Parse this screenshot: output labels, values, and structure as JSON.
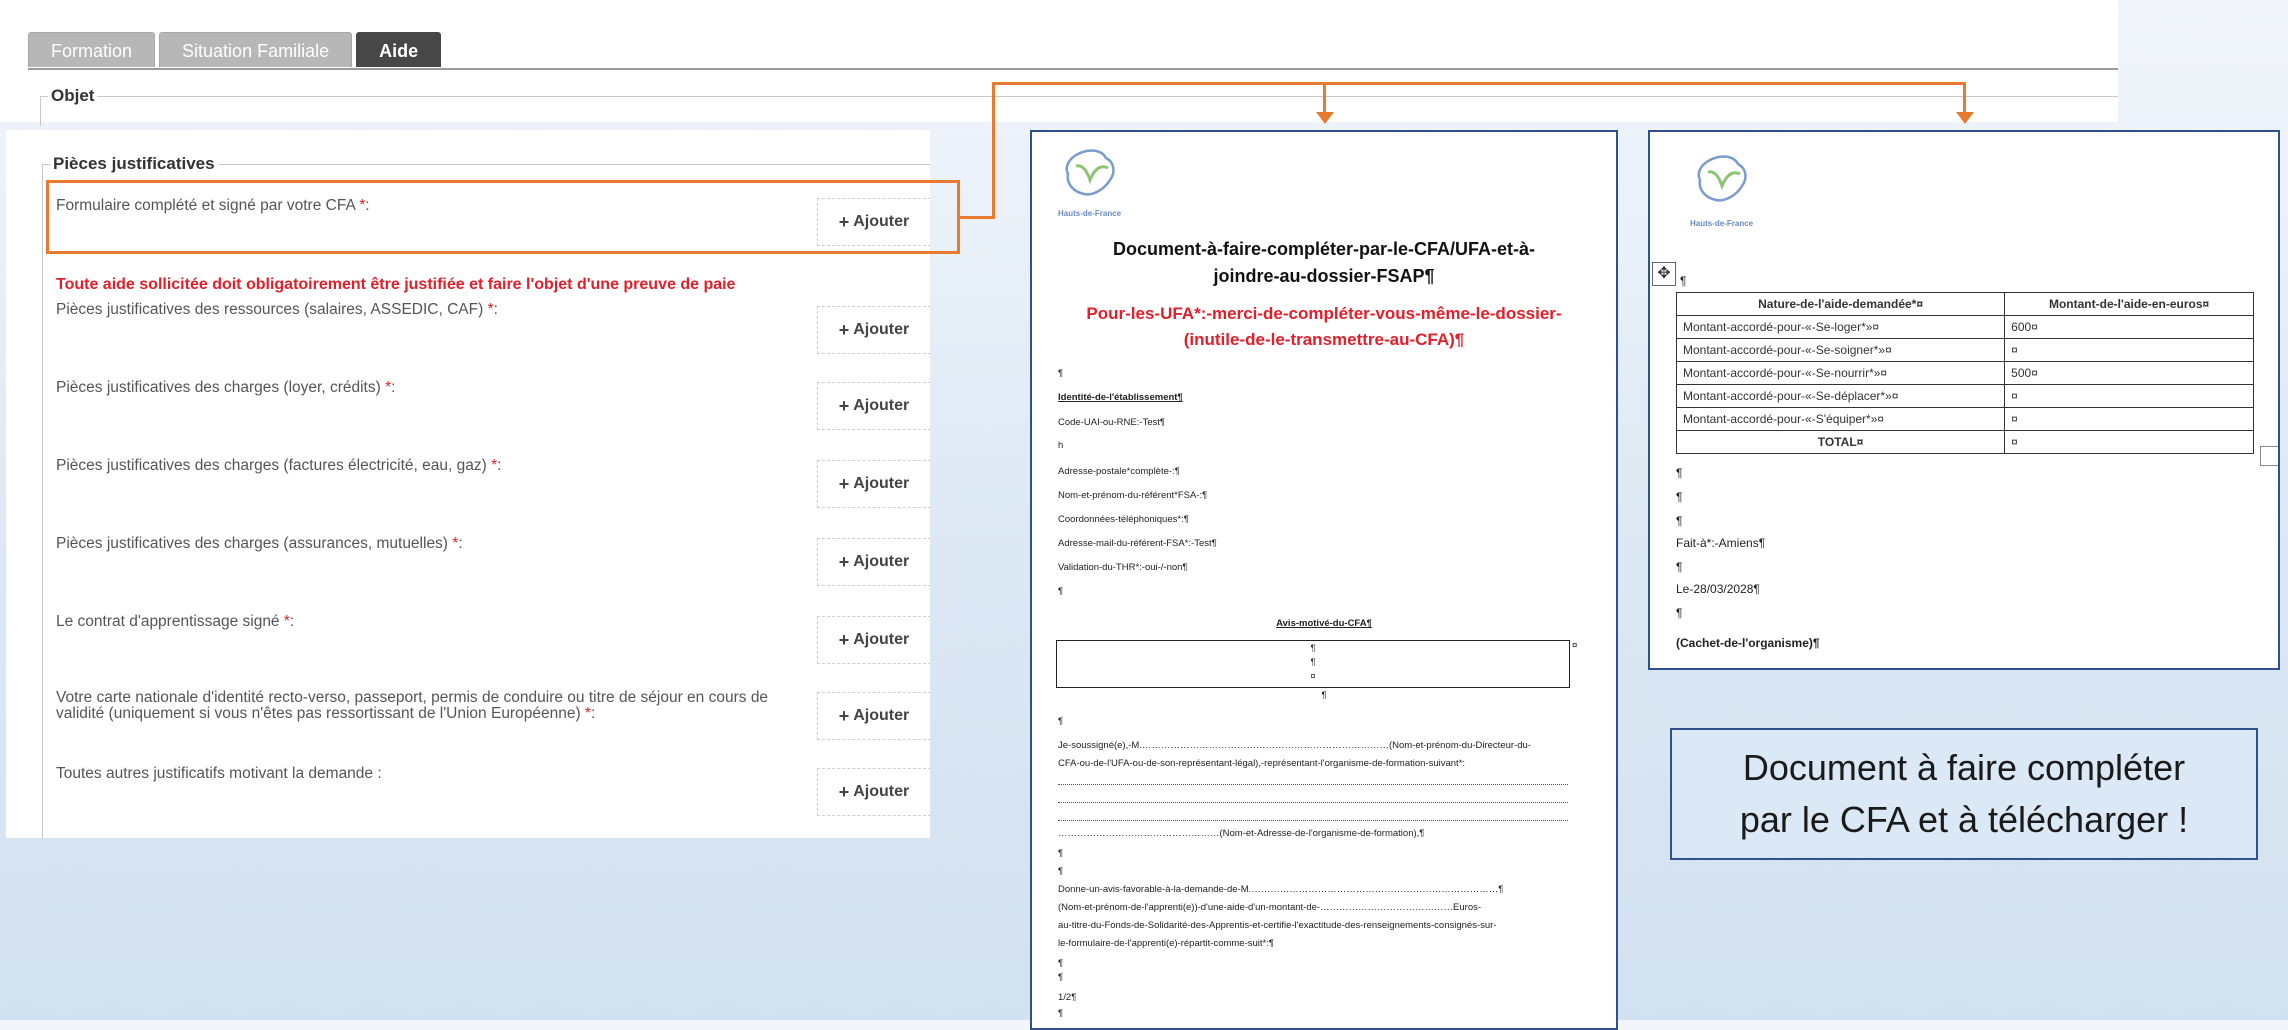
{
  "tabs": [
    {
      "label": "Formation",
      "active": false
    },
    {
      "label": "Situation Familiale",
      "active": false
    },
    {
      "label": "Aide",
      "active": true
    }
  ],
  "objet_legend": "Objet",
  "pieces": {
    "legend": "Pièces justificatives",
    "add_label": "Ajouter",
    "warning": "Toute aide sollicitée doit obligatoirement être justifiée et faire l'objet d'une preuve de paie",
    "items": [
      {
        "label": "Formulaire complété et signé par votre CFA",
        "required": "*",
        "suffix": ":"
      },
      {
        "label": "Pièces justificatives des ressources (salaires, ASSEDIC, CAF)",
        "required": "*",
        "suffix": ":"
      },
      {
        "label": "Pièces justificatives des charges (loyer, crédits)",
        "required": "*",
        "suffix": ":"
      },
      {
        "label": "Pièces justificatives des charges (factures électricité, eau, gaz)",
        "required": "*",
        "suffix": ":"
      },
      {
        "label": "Pièces justificatives des charges (assurances, mutuelles)",
        "required": "*",
        "suffix": ":"
      },
      {
        "label": "Le contrat d'apprentissage signé",
        "required": "*",
        "suffix": ":"
      },
      {
        "label": "Votre carte nationale d'identité recto-verso, passeport, permis de conduire ou titre de séjour en cours de validité (uniquement si vous n'êtes pas ressortissant de l'Union Européenne)",
        "required": "*",
        "suffix": ":"
      },
      {
        "label": "Toutes autres justificatifs motivant la demande :",
        "required": "",
        "suffix": ""
      }
    ]
  },
  "doc1": {
    "logo_caption": "Hauts-de-France",
    "title_line1": "Document-à-faire-compléter-par-le-CFA/UFA-et-à-",
    "title_line2": "joindre-au-dossier-FSAP¶",
    "red_line1": "Pour-les-UFA*:-merci-de-compléter-vous-même-le-dossier-",
    "red_line2": "(inutile-de-le-transmettre-au-CFA)¶",
    "pilcrow": "¶",
    "identite": "Identité-de-l'établissement¶",
    "code": "Code-UAI-ou-RNE:-Test¶",
    "h": "h",
    "adresse": "Adresse-postale*complète-:¶",
    "nom_ref": "Nom-et-prénom-du-référent*FSA-:¶",
    "coord": "Coordonnées-téléphoniques*:¶",
    "mail": "Adresse-mail-du-référent-FSA*:-Test¶",
    "validation": "Validation-du-THR*:-oui-/-non¶",
    "avis": "Avis-motivé-du-CFA¶",
    "box_marks": [
      "¶",
      "¶",
      "¤"
    ],
    "box_after": "¶",
    "cell_mark": "¤",
    "soussigne": "Je-soussigné(e),-M.……………………………………………………………………(Nom-et-prénom-du-Directeur-du-",
    "soussigne2": "CFA-ou-de-l'UFA-ou-de-son-représentant-légal),-représentant-l'organisme-de-formation-suivant*:",
    "nom_org": "……………………………………………(Nom-et-Adresse-de-l'organisme-de-formation),¶",
    "avis_fav": "Donne-un-avis-favorable-à-la-demande-de-M.……………………………………………………………………¶",
    "avis_fav2": "(Nom-et-prénom-de-l'apprenti(e))-d'une-aide-d'un-montant-de-……………………………………Euros-",
    "avis_fav3": "au-titre-du-Fonds-de-Solidarité-des-Apprentis-et-certifie-l'exactitude-des-renseignements-consignés-sur-",
    "avis_fav4": "le-formulaire-de-l'apprenti(e)-répartit-comme-suit*:¶",
    "page": "1/2¶"
  },
  "doc2": {
    "logo_caption": "Hauts-de-France",
    "pilcrow": "¶",
    "cell_mark": "¤",
    "col1": "Nature-de-l'aide-demandée*¤",
    "col2": "Montant-de-l'aide-en-euros¤",
    "rows": [
      {
        "nature": "Montant-accordé-pour-«-Se-loger*»¤",
        "montant": "600¤"
      },
      {
        "nature": "Montant-accordé-pour-«-Se-soigner*»¤",
        "montant": "¤"
      },
      {
        "nature": "Montant-accordé-pour-«-Se-nourrir*»¤",
        "montant": "500¤"
      },
      {
        "nature": "Montant-accordé-pour-«-Se-déplacer*»¤",
        "montant": "¤"
      },
      {
        "nature": "Montant-accordé-pour-«-S'équiper*»¤",
        "montant": "¤"
      },
      {
        "nature": "TOTAL¤",
        "montant": "¤"
      }
    ],
    "fait": "Fait-à*:-Amiens¶",
    "date": "Le-28/03/2028¶",
    "cachet": "(Cachet-de-l'organisme)¶"
  },
  "caption": {
    "line1": "Document à faire compléter",
    "line2": "par le CFA et à télécharger !"
  },
  "colors": {
    "accent_orange": "#e87a2f",
    "doc_border": "#2f4f8f",
    "required_red": "#e0202a"
  }
}
